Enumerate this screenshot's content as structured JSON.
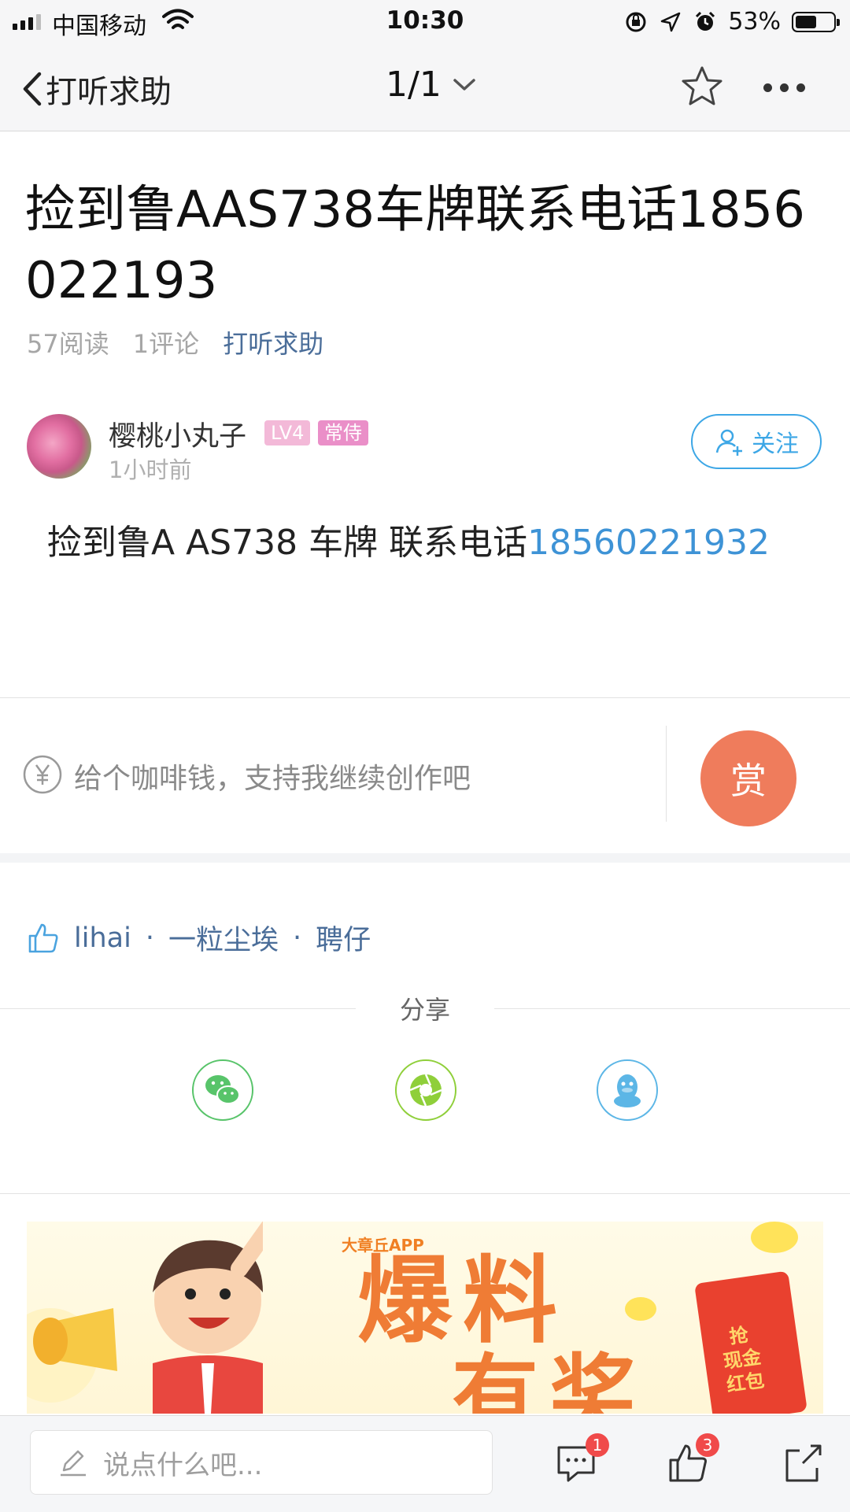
{
  "status_bar": {
    "carrier": "中国移动",
    "time": "10:30",
    "battery": "53%"
  },
  "nav": {
    "back_label": "打听求助",
    "pager": "1/1"
  },
  "post": {
    "title": "捡到鲁AAS738车牌联系电话1856022193",
    "reads": "57阅读",
    "comments": "1评论",
    "category": "打听求助",
    "content_text": "捡到鲁A AS738  车牌 联系电话",
    "content_phone": "18560221932"
  },
  "author": {
    "name": "樱桃小丸子",
    "level_badge": "LV4",
    "rank_badge": "常侍",
    "time": "1小时前",
    "follow_label": "关注"
  },
  "tip": {
    "text": "给个咖啡钱，支持我继续创作吧",
    "reward_label": "赏"
  },
  "likes": {
    "users": [
      "lihai",
      "一粒尘埃",
      "聘仔"
    ],
    "separator": "·"
  },
  "share": {
    "label": "分享"
  },
  "banner": {
    "app_name": "大章丘APP",
    "headline_1": "爆料",
    "headline_2": "有奖",
    "envelope_text": "抢\n现金\n红包"
  },
  "bottom_bar": {
    "comment_placeholder": "说点什么吧...",
    "comment_count": "1",
    "like_count": "3"
  }
}
